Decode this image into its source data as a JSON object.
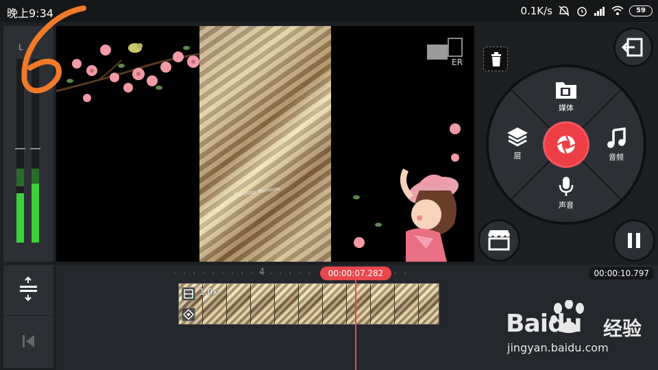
{
  "status_bar": {
    "time": "晚上9:34",
    "network_speed": "0.1K/s",
    "battery": "59"
  },
  "meter": {
    "channel_label": "L",
    "level_left": 0.27,
    "level_right": 0.32
  },
  "preview": {
    "caption": "Everyday Moments",
    "top_right_fragment": "ER"
  },
  "wheel": {
    "media_label": "媒体",
    "layer_label": "层",
    "audio_label": "音频",
    "voice_label": "声音"
  },
  "timeline": {
    "ruler_number": "4",
    "current_time": "00:00:07.282",
    "total_time": "00:00:10.797",
    "clip_speed": "1.0x"
  },
  "annotation": {
    "step_number": "6"
  },
  "watermark": {
    "logo": "Baidu",
    "logo_cn": "经验",
    "url": "jingyan.baidu.com"
  },
  "colors": {
    "accent": "#e8474c",
    "record": "#ee3e45",
    "meter_green": "#3ad13a",
    "annotation_orange": "#f07a2a"
  }
}
